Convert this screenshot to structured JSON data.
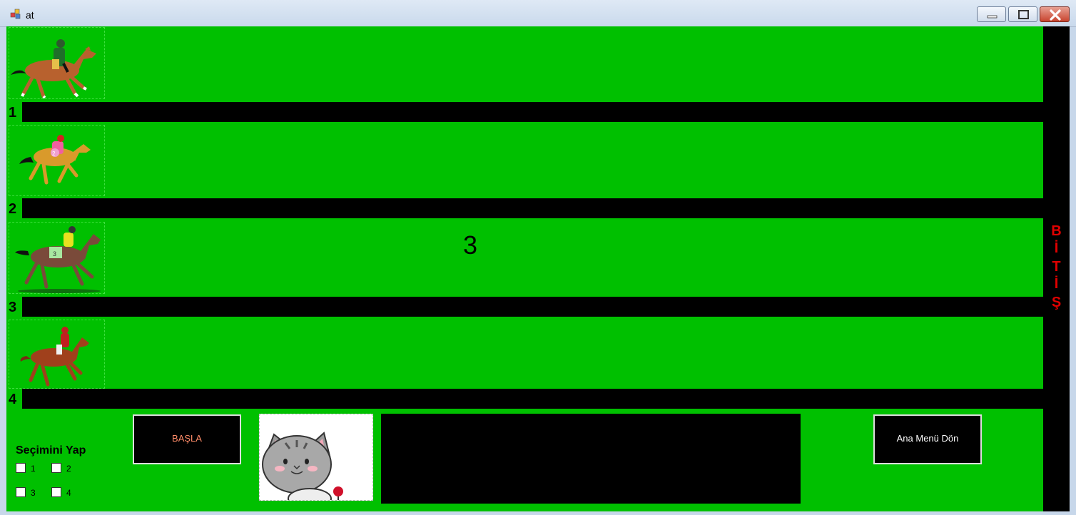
{
  "window": {
    "title": "at",
    "icons": [
      "app-icon",
      "minimize-icon",
      "maximize-icon",
      "close-icon"
    ]
  },
  "race": {
    "lanes": [
      {
        "number": "1",
        "horse": "horse-1-image"
      },
      {
        "number": "2",
        "horse": "horse-2-image"
      },
      {
        "number": "3",
        "horse": "horse-3-image"
      },
      {
        "number": "4",
        "horse": "horse-4-image"
      }
    ],
    "countdown": "3",
    "finish_letters": [
      "B",
      "İ",
      "T",
      "İ",
      "Ş"
    ],
    "finish_color": "#e00000",
    "track_color": "#00c000"
  },
  "controls": {
    "prompt": "Seçimini Yap",
    "options": [
      "1",
      "2",
      "3",
      "4"
    ],
    "start_label": "BAŞLA",
    "start_color": "#ff8c69",
    "menu_label": "Ana Menü Dön"
  }
}
